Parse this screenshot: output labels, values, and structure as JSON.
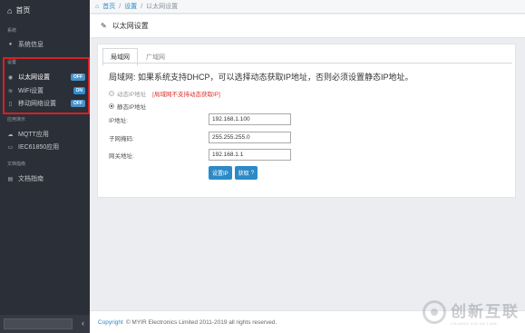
{
  "sidebar": {
    "home": "首页",
    "sections": [
      "系统",
      "设置",
      "应用演示",
      "文档指南"
    ],
    "system_items": [
      {
        "label": "系统信息",
        "icon": "info-icon"
      }
    ],
    "settings_items": [
      {
        "label": "以太网设置",
        "badge": "OFF",
        "icon": "ethernet-icon"
      },
      {
        "label": "WiFi设置",
        "badge": "ON",
        "icon": "wifi-icon"
      },
      {
        "label": "移动网络设置",
        "badge": "OFF",
        "icon": "mobile-icon"
      }
    ],
    "app_items": [
      {
        "label": "MQTT应用",
        "icon": "cloud-icon"
      },
      {
        "label": "IEC61850应用",
        "icon": "monitor-icon"
      }
    ],
    "doc_items": [
      {
        "label": "文档指南",
        "icon": "book-icon"
      }
    ],
    "collapse_glyph": "‹",
    "highlight_color": "#d81f26"
  },
  "breadcrumb": {
    "home": "首页",
    "settings": "设置",
    "current": "以太网设置",
    "separator": "/"
  },
  "page_header": {
    "title": "以太网设置"
  },
  "tabs": [
    "局域网",
    "广域网"
  ],
  "description": "局域网: 如果系统支持DHCP，可以选择动态获取IP地址，否则必须设置静态IP地址。",
  "radios": {
    "dynamic": "动态IP地址",
    "dynamic_warning": "[局域网不支持动态获取IP]",
    "static": "静态IP地址"
  },
  "fields": [
    {
      "label": "IP地址:",
      "value": "192.168.1.100"
    },
    {
      "label": "子网掩码:",
      "value": "255.255.255.0"
    },
    {
      "label": "网关地址:",
      "value": "192.168.1.1"
    }
  ],
  "buttons": {
    "set": "设置IP",
    "get": "获取"
  },
  "footer": {
    "copyright_word": "Copyright",
    "text": "© MYIR Electronics Limited 2011-2019 all rights reserved."
  },
  "watermark": {
    "main": "创新互联",
    "sub": "CHUANG XIN HU LIAN"
  },
  "colors": {
    "accent": "#2d8ac7",
    "sidebar_bg": "#2b2f37",
    "warning": "#d9312b"
  }
}
